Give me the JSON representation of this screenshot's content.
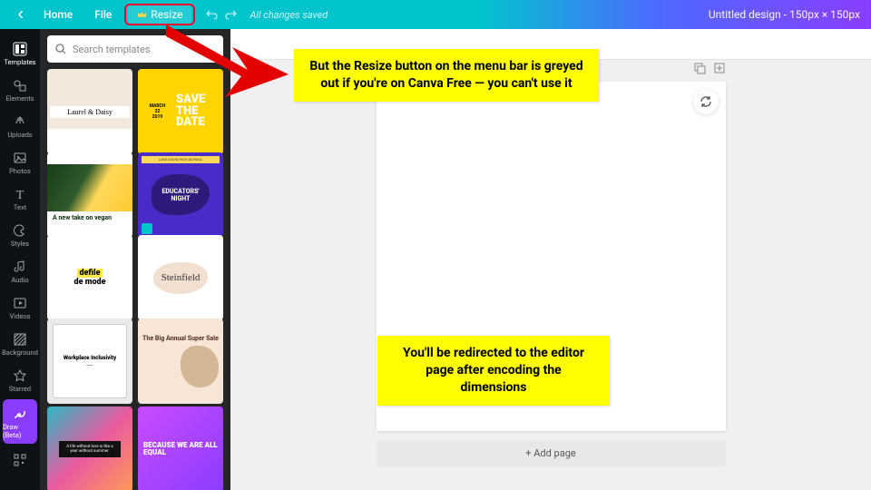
{
  "topbar": {
    "home": "Home",
    "file": "File",
    "resize": "Resize",
    "saved": "All changes saved",
    "title": "Untitled design - 150px × 150px"
  },
  "sidenav": {
    "templates": "Templates",
    "elements": "Elements",
    "uploads": "Uploads",
    "photos": "Photos",
    "text": "Text",
    "styles": "Styles",
    "audio": "Audio",
    "videos": "Videos",
    "background": "Background",
    "starred": "Starred",
    "draw": "Draw (Beta)"
  },
  "search": {
    "placeholder": "Search templates"
  },
  "templates": {
    "t1": "Laurel & Daisy",
    "t2_date": "MARCH\n22\n2019",
    "t2_big": "SAVE THE DATE",
    "t3": "A new take on vegan",
    "t4_bar": "LAKE DAVIS HIGH SCHOOL",
    "t4a": "EDUCATORS'",
    "t4b": "NIGHT",
    "t5a": "defile",
    "t5b": "de mode",
    "t6": "Steinfield",
    "t7": "Workplace Inclusivity",
    "t8": "The Big Annual Super Sale",
    "t9": "A life without love is like a year without summer.",
    "t10": "BECAUSE WE ARE ALL EQUAL"
  },
  "canvas": {
    "add_page": "+ Add page"
  },
  "notes": {
    "n1": "But the Resize button on the menu bar is greyed out if you're on Canva Free — you can't use it",
    "n2": "You'll be redirected to the editor page after encoding the dimensions"
  }
}
